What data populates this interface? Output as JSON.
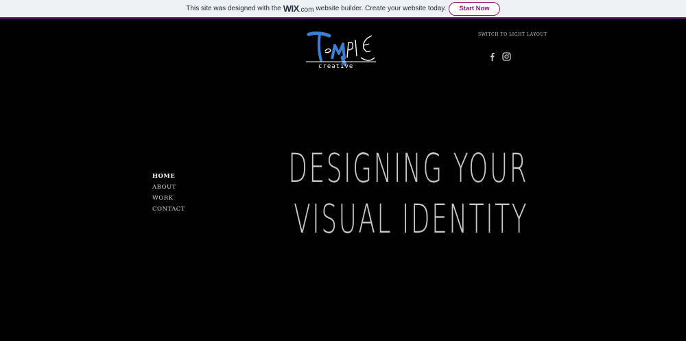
{
  "wix_banner": {
    "text_before": "This site was designed with the",
    "brand": "WIX",
    "brand_suffix": ".com",
    "text_after": "website builder. Create your website today.",
    "button_label": "Start Now"
  },
  "header": {
    "logo_word": "TeMPlE",
    "logo_sub": "creative",
    "switch_layout_label": "Switch to Light Layout",
    "socials": [
      "facebook-icon",
      "instagram-icon"
    ]
  },
  "nav": {
    "items": [
      {
        "label": "Home",
        "active": true
      },
      {
        "label": "About",
        "active": false
      },
      {
        "label": "Work",
        "active": false
      },
      {
        "label": "Contact",
        "active": false
      }
    ]
  },
  "hero": {
    "line1": "Designing your",
    "line2": "visual identity"
  },
  "colors": {
    "background": "#000000",
    "wix_accent": "#8c1a7a",
    "logo_blue": "#3a7fd0",
    "hero_text": "#c8c8c8"
  }
}
